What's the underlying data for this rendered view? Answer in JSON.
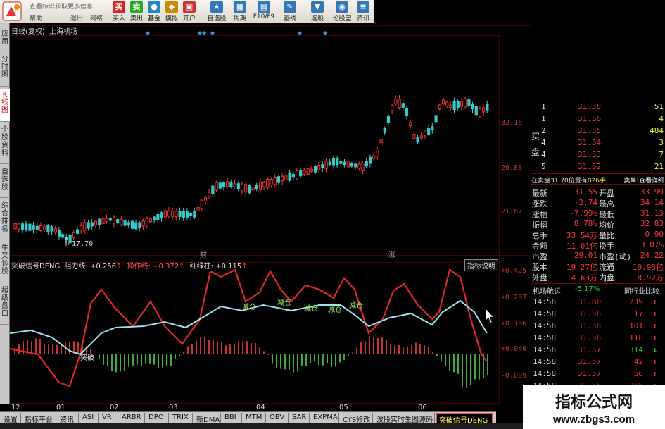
{
  "toolbar": {
    "info_text": "查看标识获取更多信息",
    "sub_labels": [
      "帮助",
      "退出",
      "网络"
    ],
    "buttons": [
      "买入",
      "卖出",
      "基金",
      "模拟",
      "开户",
      "自选股",
      "周期",
      "F10/F9",
      "画线",
      "选股",
      "论股堂",
      "资讯"
    ]
  },
  "left_tabs": [
    "应用",
    "分时图",
    "K线图",
    "个股资料",
    "自选股",
    "综合排名",
    "牛叉诊股",
    "超级盘口"
  ],
  "chart": {
    "title": "日线(复权)",
    "stock_name": "上海机场",
    "price_labels": [
      "32.16",
      "26.88",
      "21.67"
    ],
    "low_label": "17.70",
    "markers": [
      "财",
      "涨"
    ],
    "indicator_name": "突破信号DENG",
    "indicator_params": [
      {
        "label": "阻力线: +0.256",
        "arrow": "↑"
      },
      {
        "label": "操作线: +0.372",
        "arrow": "↑"
      },
      {
        "label": "红绿柱: +0.115",
        "arrow": "↑"
      }
    ],
    "indicator_button": "指标说明",
    "indicator_axis": [
      "+0.425",
      "+0.297",
      "+0.166",
      "+0.040",
      "-0.089"
    ],
    "signal_labels": [
      "突破",
      "减仓",
      "减仓",
      "减仓",
      "减仓",
      "减仓"
    ],
    "months": [
      "12",
      "01",
      "02",
      "03",
      "04",
      "05",
      "06"
    ]
  },
  "order_book": {
    "side_labels": [
      "买",
      "盘"
    ],
    "rows": [
      {
        "level": "1",
        "price": "31.58",
        "volume": "51"
      },
      {
        "level": "1",
        "price": "31.56",
        "volume": "4"
      },
      {
        "level": "2",
        "price": "31.55",
        "volume": "484"
      },
      {
        "level": "4",
        "price": "31.54",
        "volume": "3"
      },
      {
        "level": "4",
        "price": "31.53",
        "volume": "7"
      },
      {
        "level": "5",
        "price": "31.52",
        "volume": "21"
      }
    ],
    "queue_text": "在卖盘31.70位置有",
    "queue_hands": "826手",
    "queue_button": "卖单!查看详细"
  },
  "quote": [
    {
      "l1": "最新",
      "v1": "31.55",
      "l2": "开盘",
      "v2": "33.99"
    },
    {
      "l1": "涨跌",
      "v1": "-2.74",
      "l2": "最高",
      "v2": "34.14"
    },
    {
      "l1": "涨幅",
      "v1": "-7.99%",
      "l2": "最低",
      "v2": "31.13"
    },
    {
      "l1": "振幅",
      "v1": "8.78%",
      "l2": "均价",
      "v2": "32.83"
    },
    {
      "l1": "总手",
      "v1": "33.54万",
      "l2": "量比",
      "v2": "0.90"
    },
    {
      "l1": "金额",
      "v1": "11.01亿",
      "l2": "换手",
      "v2": "3.07%"
    },
    {
      "l1": "市盈",
      "v1": "29.01",
      "l2": "市盈(动)",
      "v2": "24.22"
    },
    {
      "l1": "股本",
      "v1": "19.27亿",
      "l2": "流通",
      "v2": "10.93亿"
    },
    {
      "l1": "外盘",
      "v1": "14.63万",
      "l2": "内盘",
      "v2": "18.92万"
    }
  ],
  "sector": {
    "name": "机场航运",
    "change": "-5.17%",
    "button": "同行业比较"
  },
  "ticks": [
    {
      "time": "14:58",
      "price": "31.60",
      "vol": "239",
      "dir": "up"
    },
    {
      "time": "14:58",
      "price": "31.58",
      "vol": "17",
      "dir": "up"
    },
    {
      "time": "14:58",
      "price": "31.58",
      "vol": "101",
      "dir": "up"
    },
    {
      "time": "14:58",
      "price": "31.58",
      "vol": "118",
      "dir": "up"
    },
    {
      "time": "14:58",
      "price": "31.57",
      "vol": "314",
      "dir": "down"
    },
    {
      "time": "14:58",
      "price": "31.57",
      "vol": "42",
      "dir": "up"
    },
    {
      "time": "14:58",
      "price": "31.57",
      "vol": "56",
      "dir": "up"
    },
    {
      "time": "14:58",
      "price": "31.55",
      "vol": "265",
      "dir": "up"
    }
  ],
  "bottom_tabs": [
    "设置",
    "指标平台",
    "资讯",
    "ASI",
    "VR",
    "ARBR",
    "DPO",
    "TRIX",
    "新DMA",
    "BBI",
    "MTM",
    "OBV",
    "SAR",
    "EXPMA",
    "CYS修改",
    "波段实时生图源码",
    "突破信号DENG"
  ],
  "watermark": {
    "title": "指标公式网",
    "url": "www.zbgs3.com"
  },
  "colors": {
    "up": "#ff3333",
    "down": "#33cccc",
    "line_red": "#e02828",
    "line_cyan": "#9ee6ee",
    "bg": "#000000"
  }
}
